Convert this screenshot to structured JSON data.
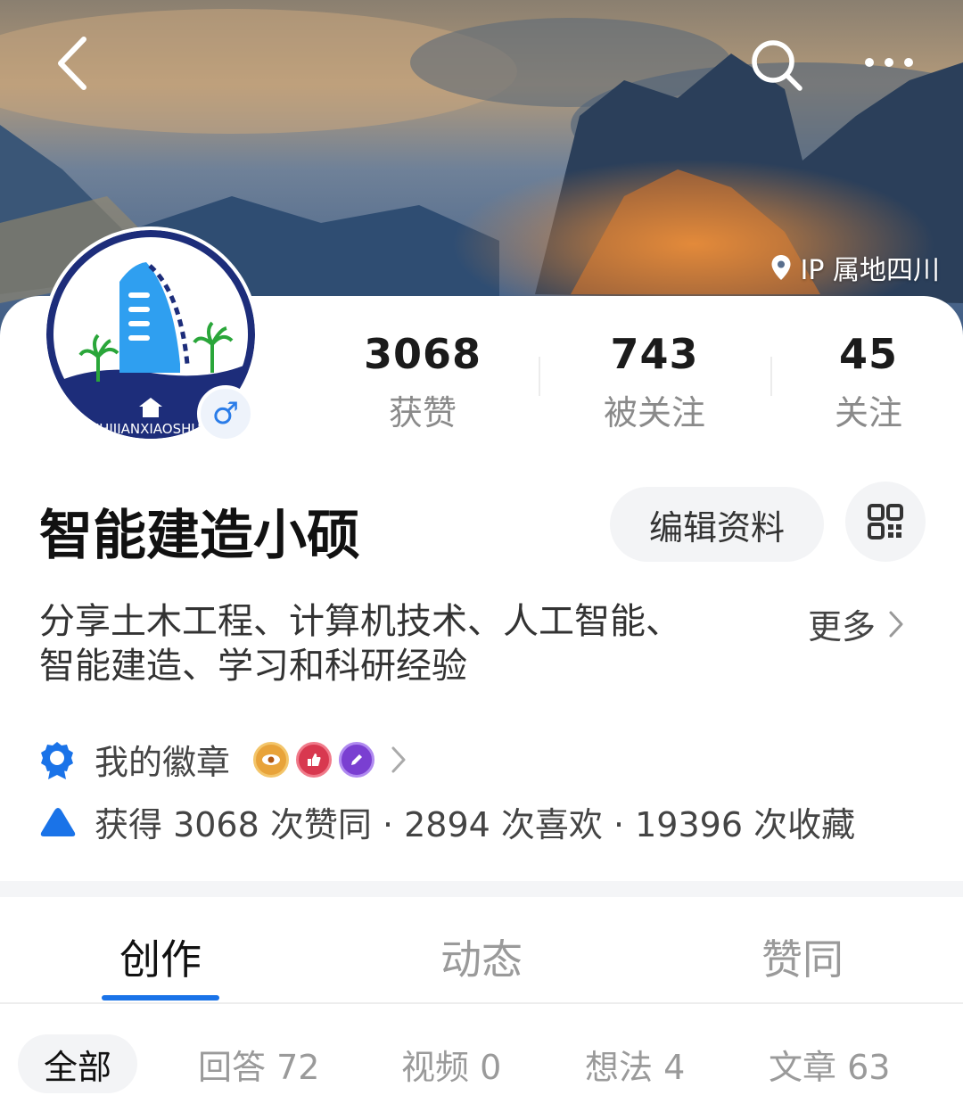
{
  "header": {
    "ip_location": "IP 属地四川"
  },
  "profile": {
    "name": "智能建造小硕",
    "logo_text": "ZHIJIANXIAOSHUO",
    "gender_symbol": "♂",
    "edit_button": "编辑资料",
    "bio_line1": "分享土木工程、计算机技术、人工智能、",
    "bio_line2": "智能建造、学习和科研经验",
    "more_label": "更多"
  },
  "stats": [
    {
      "value": "3068",
      "label": "获赞"
    },
    {
      "value": "743",
      "label": "被关注"
    },
    {
      "value": "45",
      "label": "关注"
    }
  ],
  "badges": {
    "label": "我的徽章",
    "icons": [
      "eye-badge",
      "thumbs-up-badge",
      "pen-badge"
    ]
  },
  "achievements": {
    "text": "获得 3068 次赞同 · 2894 次喜欢 · 19396 次收藏"
  },
  "tabs": [
    {
      "label": "创作"
    },
    {
      "label": "动态"
    },
    {
      "label": "赞同"
    }
  ],
  "subtabs": [
    {
      "label": "全部"
    },
    {
      "label": "回答 72"
    },
    {
      "label": "视频 0"
    },
    {
      "label": "想法 4"
    },
    {
      "label": "文章 63"
    }
  ],
  "colors": {
    "accent": "#1a73e8",
    "avatar_navy": "#1d2d7a",
    "avatar_blue": "#2f9ff0"
  }
}
